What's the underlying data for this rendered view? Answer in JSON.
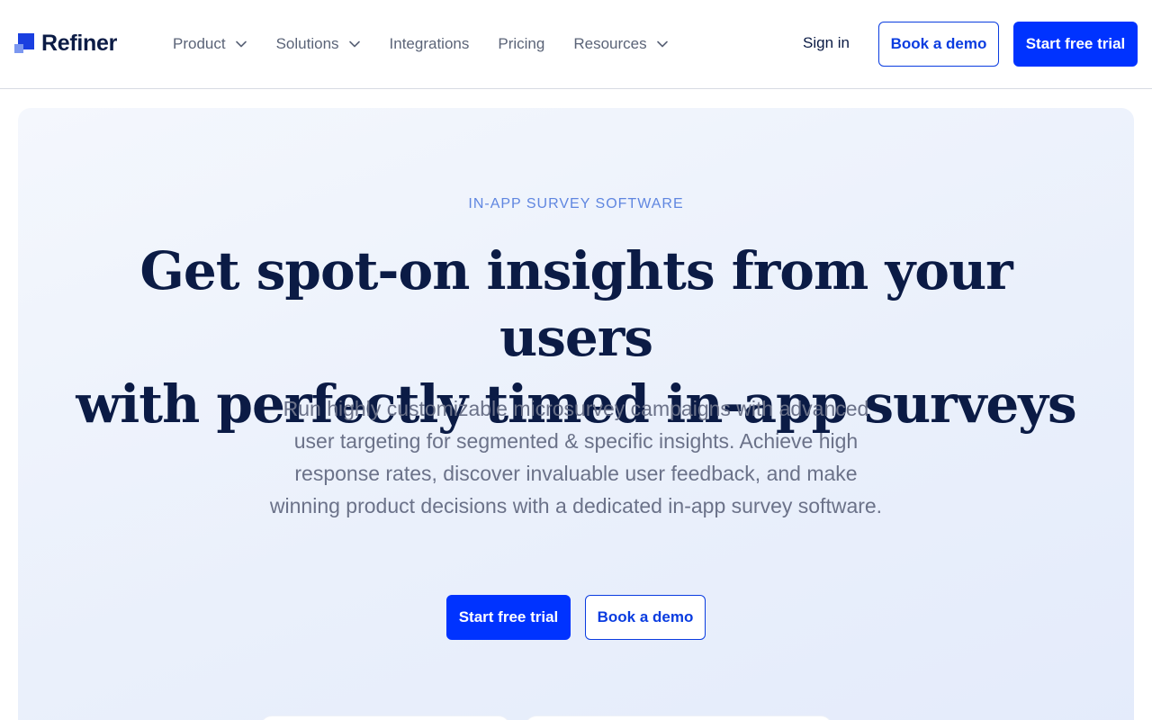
{
  "brand": {
    "name": "Refiner",
    "colors": {
      "primary": "#0033ff",
      "navy": "#0b1b45",
      "accent_light": "#5f86e0"
    }
  },
  "nav": {
    "items": [
      {
        "label": "Product",
        "has_dropdown": true
      },
      {
        "label": "Solutions",
        "has_dropdown": true
      },
      {
        "label": "Integrations",
        "has_dropdown": false
      },
      {
        "label": "Pricing",
        "has_dropdown": false
      },
      {
        "label": "Resources",
        "has_dropdown": true
      }
    ],
    "sign_in": "Sign in",
    "book_demo": "Book a demo",
    "start_trial": "Start free trial"
  },
  "hero": {
    "eyebrow": "IN-APP SURVEY SOFTWARE",
    "headline_line1": "Get spot-on insights from your users",
    "headline_line2": "with perfectly timed in-app surveys",
    "subtext": "Run highly customizable microsurvey campaigns with advanced user targeting for segmented & specific insights. Achieve high response rates, discover invaluable user feedback, and make winning product decisions with a dedicated in-app survey software.",
    "cta_primary": "Start free trial",
    "cta_secondary": "Book a demo"
  }
}
